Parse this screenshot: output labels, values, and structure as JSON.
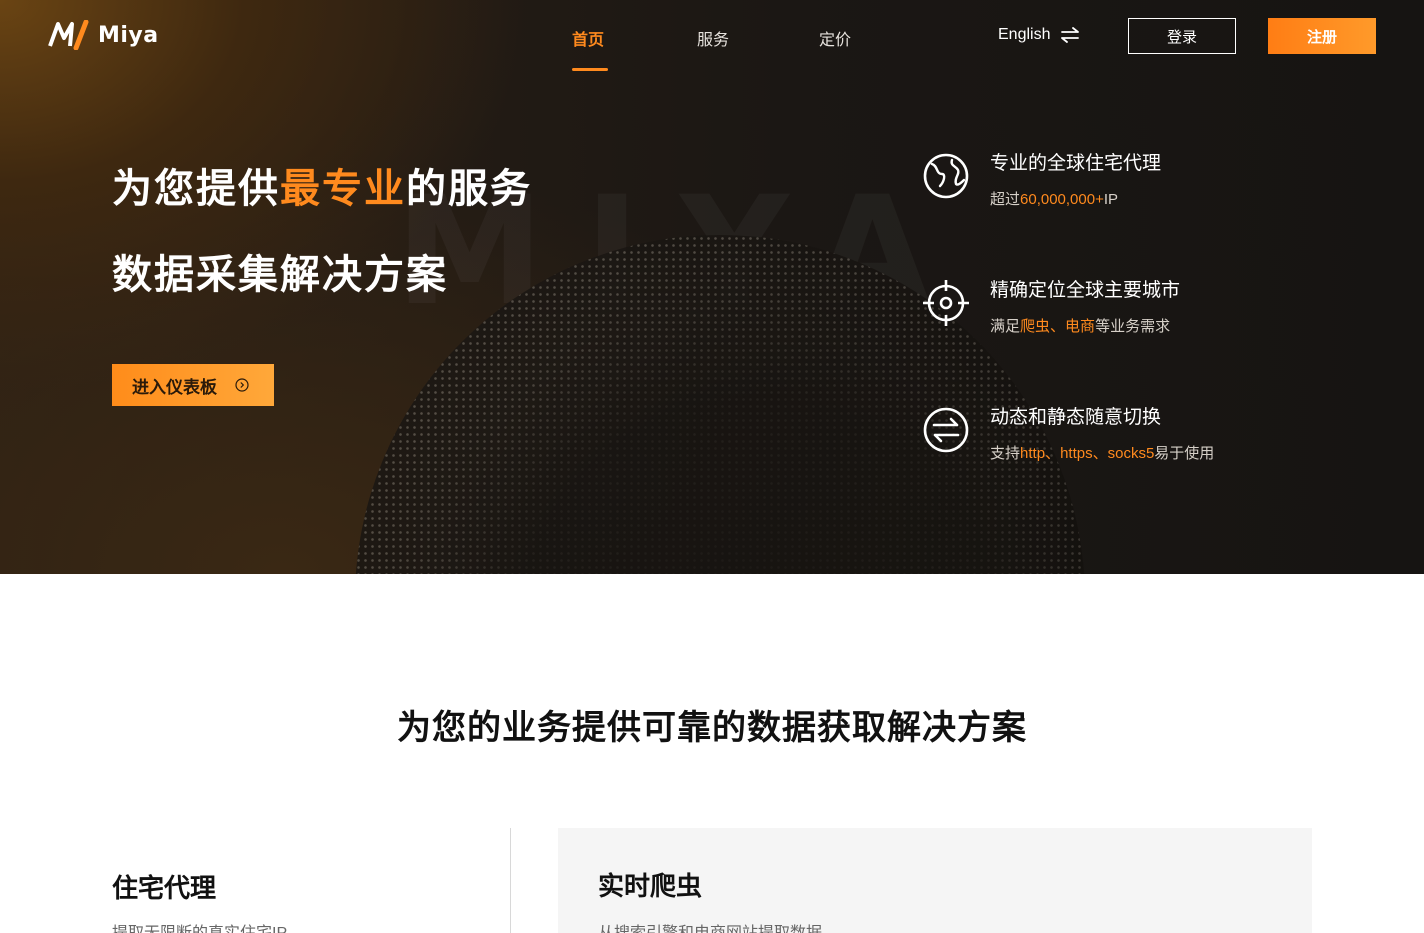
{
  "brand": {
    "name": "Miya"
  },
  "nav": {
    "items": [
      {
        "label": "首页",
        "active": true
      },
      {
        "label": "服务",
        "active": false
      },
      {
        "label": "定价",
        "active": false
      }
    ],
    "language": "English",
    "login": "登录",
    "register": "注册"
  },
  "hero": {
    "title_line1_prefix": "为您提供",
    "title_line1_highlight": "最专业",
    "title_line1_suffix": "的服务",
    "title_line2": "数据采集解决方案",
    "cta": "进入仪表板",
    "watermark": "MIYA"
  },
  "features": [
    {
      "icon": "globe-icon",
      "title": "专业的全球住宅代理",
      "sub": {
        "p1": "超过",
        "h1": "60,000,000+",
        "p2": "IP"
      }
    },
    {
      "icon": "target-icon",
      "title": "精确定位全球主要城市",
      "sub": {
        "p1": "满足",
        "h1": "爬虫",
        "p2": "、",
        "h2": "电商",
        "p3": "等业务需求"
      }
    },
    {
      "icon": "switch-icon",
      "title": "动态和静态随意切换",
      "sub": {
        "p1": "支持",
        "h1": "http",
        "p2": "、",
        "h2": "https",
        "p3": "、",
        "h3": "socks5",
        "p4": "易于使用"
      }
    }
  ],
  "section": {
    "title": "为您的业务提供可靠的数据获取解决方案",
    "cards": [
      {
        "title": "住宅代理",
        "desc": "提取无限断的真实住宅IP"
      },
      {
        "title": "实时爬虫",
        "desc": "从搜索引擎和电商网站提取数据"
      }
    ]
  },
  "colors": {
    "accent": "#ff8a1e",
    "hero_bg": "#1b1714",
    "text_dark": "#111111"
  }
}
